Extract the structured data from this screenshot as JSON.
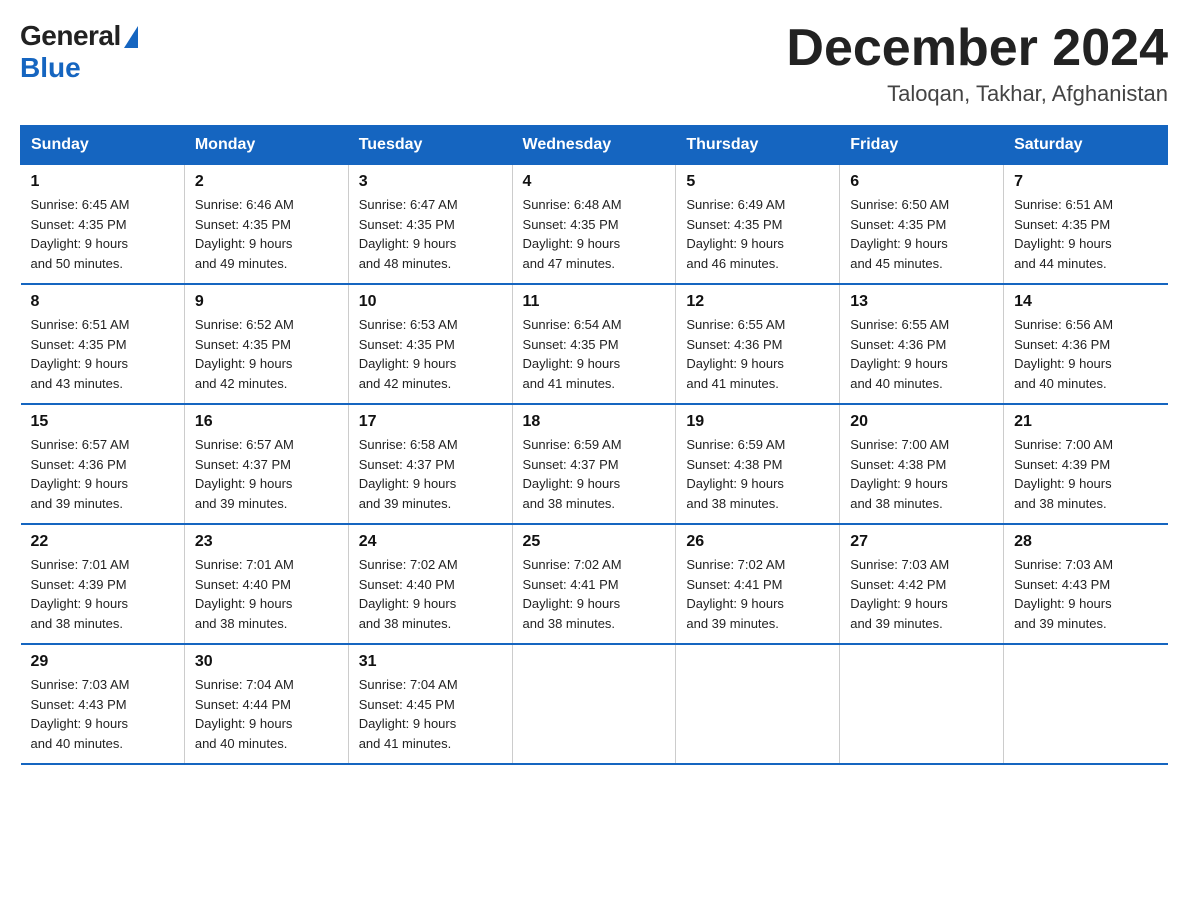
{
  "logo": {
    "general": "General",
    "blue": "Blue"
  },
  "header": {
    "month": "December 2024",
    "location": "Taloqan, Takhar, Afghanistan"
  },
  "weekdays": [
    "Sunday",
    "Monday",
    "Tuesday",
    "Wednesday",
    "Thursday",
    "Friday",
    "Saturday"
  ],
  "weeks": [
    [
      {
        "day": "1",
        "sunrise": "6:45 AM",
        "sunset": "4:35 PM",
        "daylight": "9 hours and 50 minutes."
      },
      {
        "day": "2",
        "sunrise": "6:46 AM",
        "sunset": "4:35 PM",
        "daylight": "9 hours and 49 minutes."
      },
      {
        "day": "3",
        "sunrise": "6:47 AM",
        "sunset": "4:35 PM",
        "daylight": "9 hours and 48 minutes."
      },
      {
        "day": "4",
        "sunrise": "6:48 AM",
        "sunset": "4:35 PM",
        "daylight": "9 hours and 47 minutes."
      },
      {
        "day": "5",
        "sunrise": "6:49 AM",
        "sunset": "4:35 PM",
        "daylight": "9 hours and 46 minutes."
      },
      {
        "day": "6",
        "sunrise": "6:50 AM",
        "sunset": "4:35 PM",
        "daylight": "9 hours and 45 minutes."
      },
      {
        "day": "7",
        "sunrise": "6:51 AM",
        "sunset": "4:35 PM",
        "daylight": "9 hours and 44 minutes."
      }
    ],
    [
      {
        "day": "8",
        "sunrise": "6:51 AM",
        "sunset": "4:35 PM",
        "daylight": "9 hours and 43 minutes."
      },
      {
        "day": "9",
        "sunrise": "6:52 AM",
        "sunset": "4:35 PM",
        "daylight": "9 hours and 42 minutes."
      },
      {
        "day": "10",
        "sunrise": "6:53 AM",
        "sunset": "4:35 PM",
        "daylight": "9 hours and 42 minutes."
      },
      {
        "day": "11",
        "sunrise": "6:54 AM",
        "sunset": "4:35 PM",
        "daylight": "9 hours and 41 minutes."
      },
      {
        "day": "12",
        "sunrise": "6:55 AM",
        "sunset": "4:36 PM",
        "daylight": "9 hours and 41 minutes."
      },
      {
        "day": "13",
        "sunrise": "6:55 AM",
        "sunset": "4:36 PM",
        "daylight": "9 hours and 40 minutes."
      },
      {
        "day": "14",
        "sunrise": "6:56 AM",
        "sunset": "4:36 PM",
        "daylight": "9 hours and 40 minutes."
      }
    ],
    [
      {
        "day": "15",
        "sunrise": "6:57 AM",
        "sunset": "4:36 PM",
        "daylight": "9 hours and 39 minutes."
      },
      {
        "day": "16",
        "sunrise": "6:57 AM",
        "sunset": "4:37 PM",
        "daylight": "9 hours and 39 minutes."
      },
      {
        "day": "17",
        "sunrise": "6:58 AM",
        "sunset": "4:37 PM",
        "daylight": "9 hours and 39 minutes."
      },
      {
        "day": "18",
        "sunrise": "6:59 AM",
        "sunset": "4:37 PM",
        "daylight": "9 hours and 38 minutes."
      },
      {
        "day": "19",
        "sunrise": "6:59 AM",
        "sunset": "4:38 PM",
        "daylight": "9 hours and 38 minutes."
      },
      {
        "day": "20",
        "sunrise": "7:00 AM",
        "sunset": "4:38 PM",
        "daylight": "9 hours and 38 minutes."
      },
      {
        "day": "21",
        "sunrise": "7:00 AM",
        "sunset": "4:39 PM",
        "daylight": "9 hours and 38 minutes."
      }
    ],
    [
      {
        "day": "22",
        "sunrise": "7:01 AM",
        "sunset": "4:39 PM",
        "daylight": "9 hours and 38 minutes."
      },
      {
        "day": "23",
        "sunrise": "7:01 AM",
        "sunset": "4:40 PM",
        "daylight": "9 hours and 38 minutes."
      },
      {
        "day": "24",
        "sunrise": "7:02 AM",
        "sunset": "4:40 PM",
        "daylight": "9 hours and 38 minutes."
      },
      {
        "day": "25",
        "sunrise": "7:02 AM",
        "sunset": "4:41 PM",
        "daylight": "9 hours and 38 minutes."
      },
      {
        "day": "26",
        "sunrise": "7:02 AM",
        "sunset": "4:41 PM",
        "daylight": "9 hours and 39 minutes."
      },
      {
        "day": "27",
        "sunrise": "7:03 AM",
        "sunset": "4:42 PM",
        "daylight": "9 hours and 39 minutes."
      },
      {
        "day": "28",
        "sunrise": "7:03 AM",
        "sunset": "4:43 PM",
        "daylight": "9 hours and 39 minutes."
      }
    ],
    [
      {
        "day": "29",
        "sunrise": "7:03 AM",
        "sunset": "4:43 PM",
        "daylight": "9 hours and 40 minutes."
      },
      {
        "day": "30",
        "sunrise": "7:04 AM",
        "sunset": "4:44 PM",
        "daylight": "9 hours and 40 minutes."
      },
      {
        "day": "31",
        "sunrise": "7:04 AM",
        "sunset": "4:45 PM",
        "daylight": "9 hours and 41 minutes."
      },
      null,
      null,
      null,
      null
    ]
  ],
  "labels": {
    "sunrise": "Sunrise:",
    "sunset": "Sunset:",
    "daylight": "Daylight:"
  }
}
